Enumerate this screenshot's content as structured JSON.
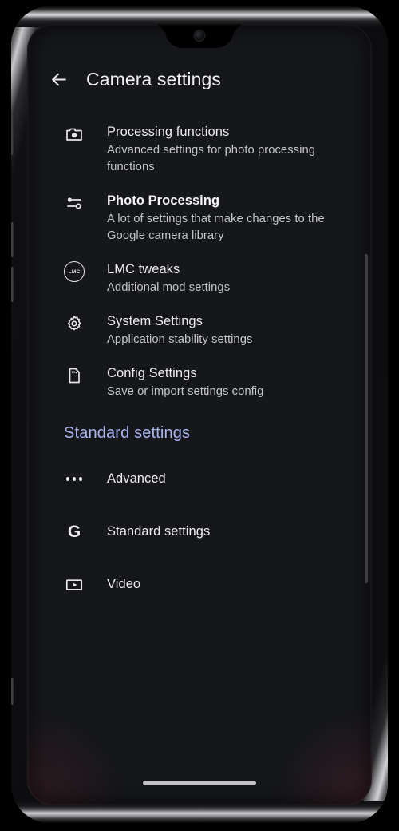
{
  "device": {
    "notch_type": "waterdrop-notch",
    "front_camera": "front-camera",
    "gesture_nav_pill": "gesture-navigation-pill",
    "side_buttons": [
      "power-button",
      "volume-up-button",
      "volume-down-button",
      "extra-button"
    ]
  },
  "colors": {
    "screen_background": "#16171b",
    "title_text": "#f0f0f2",
    "item_title": "#ececed",
    "item_subtitle": "#c3c4c8",
    "section_header_accent": "#a9b4ef",
    "icon": "#e6e6ea",
    "scrollbar_thumb": "#55565c",
    "gesture_pill": "#c6c6cb"
  },
  "appbar": {
    "back_icon": "arrow-back-icon",
    "title": "Camera settings"
  },
  "list": [
    {
      "icon": "camera-icon",
      "title": "Processing functions",
      "subtitle": "Advanced settings for photo processing functions",
      "bold": false
    },
    {
      "icon": "tune-sliders-icon",
      "title": "Photo Processing",
      "subtitle": "A lot of settings that make changes to the Google camera library",
      "bold": true
    },
    {
      "icon": "lmc-badge-icon",
      "title": "LMC tweaks",
      "subtitle": "Additional mod settings",
      "bold": false
    },
    {
      "icon": "gear-icon",
      "title": "System Settings",
      "subtitle": "Application stability settings",
      "bold": false
    },
    {
      "icon": "sd-card-icon",
      "title": "Config Settings",
      "subtitle": "Save or import settings config",
      "bold": false
    }
  ],
  "section": {
    "header": "Standard settings"
  },
  "section_list": [
    {
      "icon": "more-horizontal-icon",
      "title": "Advanced"
    },
    {
      "icon": "google-g-icon",
      "title": "Standard settings"
    },
    {
      "icon": "video-play-icon",
      "title": "Video"
    }
  ],
  "lmc_badge_text": "LMC",
  "google_g_text": "G",
  "scrollbar": {
    "visible": true
  }
}
